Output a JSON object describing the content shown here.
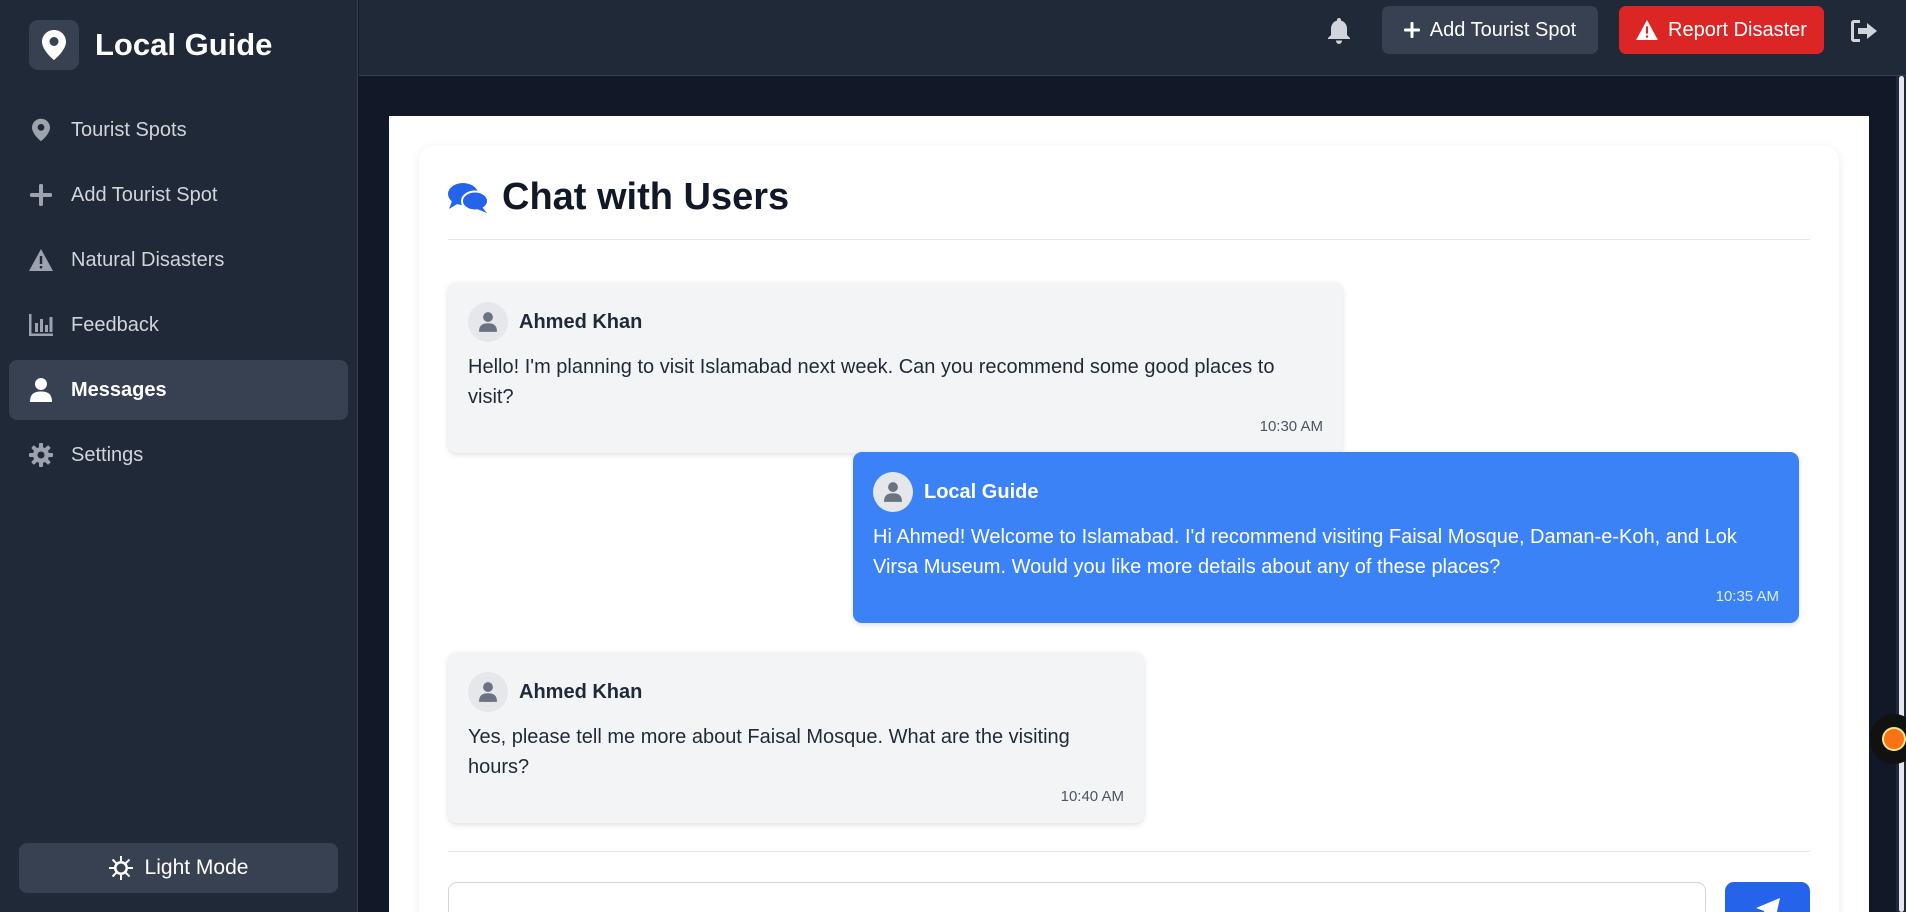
{
  "app": {
    "title": "Local Guide"
  },
  "sidebar": {
    "items": [
      {
        "label": "Tourist Spots",
        "icon": "map-pin-icon"
      },
      {
        "label": "Add Tourist Spot",
        "icon": "plus-icon"
      },
      {
        "label": "Natural Disasters",
        "icon": "warning-icon"
      },
      {
        "label": "Feedback",
        "icon": "bar-chart-icon"
      },
      {
        "label": "Messages",
        "icon": "user-icon",
        "active": true
      },
      {
        "label": "Settings",
        "icon": "gear-icon"
      }
    ],
    "theme_toggle": "Light Mode"
  },
  "header": {
    "add_button": "Add Tourist Spot",
    "report_button": "Report Disaster"
  },
  "chat": {
    "title": "Chat with Users",
    "messages": [
      {
        "sender": "Ahmed Khan",
        "text": "Hello! I'm planning to visit Islamabad next week. Can you recommend some good places to visit?",
        "time": "10:30 AM",
        "direction": "incoming"
      },
      {
        "sender": "Local Guide",
        "text": "Hi Ahmed! Welcome to Islamabad. I'd recommend visiting Faisal Mosque, Daman-e-Koh, and Lok Virsa Museum. Would you like more details about any of these places?",
        "time": "10:35 AM",
        "direction": "outgoing"
      },
      {
        "sender": "Ahmed Khan",
        "text": "Yes, please tell me more about Faisal Mosque. What are the visiting hours?",
        "time": "10:40 AM",
        "direction": "incoming"
      }
    ]
  },
  "colors": {
    "sidebar_bg": "#1f2937",
    "accent_blue": "#3b82f6",
    "danger_red": "#dc2626"
  }
}
